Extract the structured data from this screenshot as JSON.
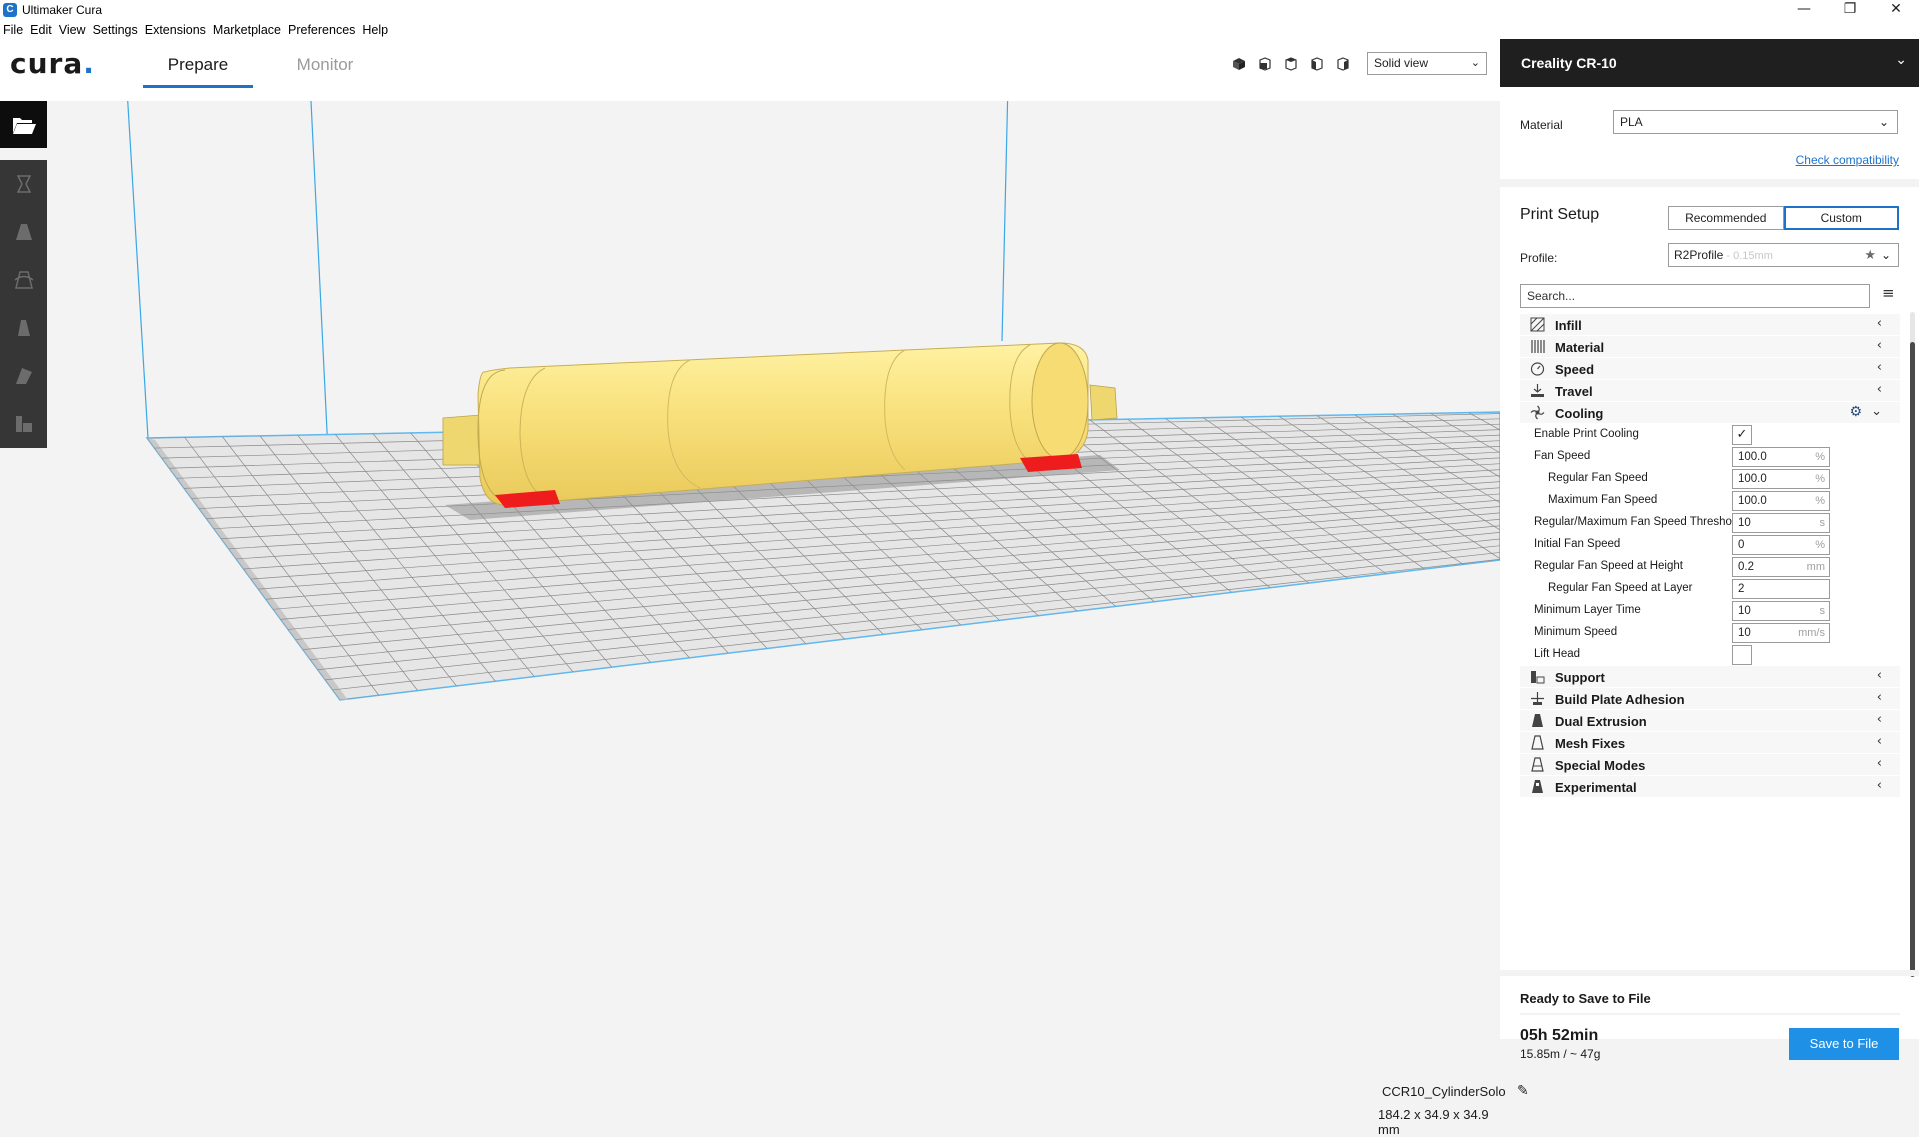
{
  "window": {
    "title": "Ultimaker Cura",
    "app_icon_letter": "C",
    "minimize": "—",
    "maximize": "❐",
    "close": "✕"
  },
  "menubar": [
    "File",
    "Edit",
    "View",
    "Settings",
    "Extensions",
    "Marketplace",
    "Preferences",
    "Help"
  ],
  "header": {
    "logo": "cura",
    "logo_dot": ".",
    "tabs": [
      {
        "label": "Prepare",
        "active": true
      },
      {
        "label": "Monitor",
        "active": false
      }
    ],
    "view_mode": "Solid view"
  },
  "left_toolbar": [
    "open-file-icon",
    "translate-icon",
    "scale-icon",
    "rotate-icon",
    "mirror-icon",
    "per-model-settings-icon",
    "support-blocker-icon"
  ],
  "viewport": {
    "model_name": "CCR10_CylinderSolo",
    "model_dimensions": "184.2 x 34.9 x 34.9 mm"
  },
  "sidebar": {
    "printer_name": "Creality CR-10",
    "material_label": "Material",
    "material_value": "PLA",
    "check_compatibility": "Check compatibility",
    "print_setup_title": "Print Setup",
    "mode_recommended": "Recommended",
    "mode_custom": "Custom",
    "profile_label": "Profile:",
    "profile_name": "R2Profile",
    "profile_sub": " - 0.15mm",
    "search_placeholder": "Search...",
    "categories_top": [
      {
        "label": "Infill",
        "icon": "infill-icon"
      },
      {
        "label": "Material",
        "icon": "material-icon"
      },
      {
        "label": "Speed",
        "icon": "speed-icon"
      },
      {
        "label": "Travel",
        "icon": "travel-icon"
      },
      {
        "label": "Cooling",
        "icon": "cooling-icon"
      }
    ],
    "cooling_settings": [
      {
        "label": "Enable Print Cooling",
        "type": "checkbox",
        "checked": true,
        "indent": 1
      },
      {
        "label": "Fan Speed",
        "value": "100.0",
        "unit": "%",
        "indent": 1
      },
      {
        "label": "Regular Fan Speed",
        "value": "100.0",
        "unit": "%",
        "indent": 2
      },
      {
        "label": "Maximum Fan Speed",
        "value": "100.0",
        "unit": "%",
        "indent": 2
      },
      {
        "label": "Regular/Maximum Fan Speed Threshold",
        "value": "10",
        "unit": "s",
        "indent": 1
      },
      {
        "label": "Initial Fan Speed",
        "value": "0",
        "unit": "%",
        "indent": 1
      },
      {
        "label": "Regular Fan Speed at Height",
        "value": "0.2",
        "unit": "mm",
        "indent": 1
      },
      {
        "label": "Regular Fan Speed at Layer",
        "value": "2",
        "unit": "",
        "indent": 2
      },
      {
        "label": "Minimum Layer Time",
        "value": "10",
        "unit": "s",
        "indent": 1
      },
      {
        "label": "Minimum Speed",
        "value": "10",
        "unit": "mm/s",
        "indent": 1
      },
      {
        "label": "Lift Head",
        "type": "checkbox",
        "checked": false,
        "indent": 1
      }
    ],
    "categories_bottom": [
      {
        "label": "Support",
        "icon": "support-icon"
      },
      {
        "label": "Build Plate Adhesion",
        "icon": "adhesion-icon"
      },
      {
        "label": "Dual Extrusion",
        "icon": "dual-extrusion-icon"
      },
      {
        "label": "Mesh Fixes",
        "icon": "mesh-fixes-icon"
      },
      {
        "label": "Special Modes",
        "icon": "special-modes-icon"
      },
      {
        "label": "Experimental",
        "icon": "experimental-icon"
      }
    ],
    "ready_label": "Ready to Save to File",
    "print_time": "05h 52min",
    "print_material": "15.85m / ~ 47g",
    "save_button": "Save to File"
  },
  "colors": {
    "accent": "#1e73c9",
    "model": "#f9e27a",
    "overhang": "#e81d1d",
    "build_volume": "#56b4e9"
  }
}
